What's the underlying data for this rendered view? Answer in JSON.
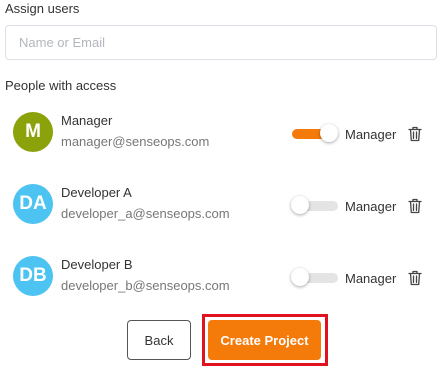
{
  "assign": {
    "label": "Assign users",
    "search_placeholder": "Name or Email",
    "search_value": ""
  },
  "people": {
    "label": "People with access",
    "list": [
      {
        "initials": "M",
        "name": "Manager",
        "email": "manager@senseops.com",
        "role_label": "Manager",
        "is_manager": true,
        "avatar_color": "#8ca20a"
      },
      {
        "initials": "DA",
        "name": "Developer A",
        "email": "developer_a@senseops.com",
        "role_label": "Manager",
        "is_manager": false,
        "avatar_color": "#4cc3f0"
      },
      {
        "initials": "DB",
        "name": "Developer B",
        "email": "developer_b@senseops.com",
        "role_label": "Manager",
        "is_manager": false,
        "avatar_color": "#4cc3f0"
      }
    ]
  },
  "actions": {
    "back_label": "Back",
    "create_label": "Create Project"
  },
  "colors": {
    "accent": "#f47a0a",
    "highlight": "#e0121f"
  },
  "icons": {
    "delete": "trash-icon"
  }
}
